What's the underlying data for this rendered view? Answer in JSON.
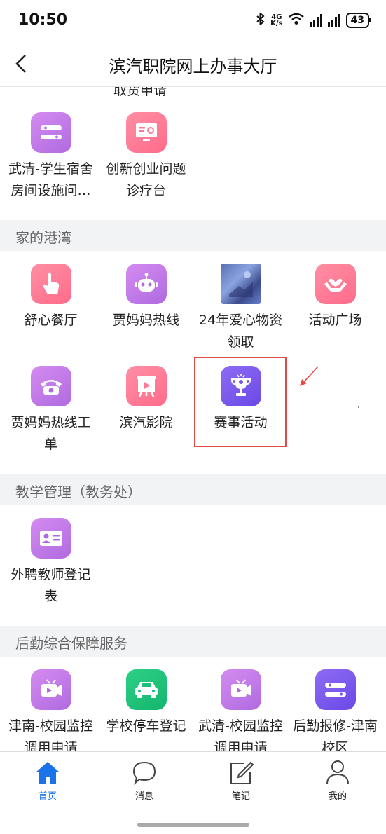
{
  "status": {
    "time": "10:50",
    "net_top": "4G",
    "net_bottom": "K/s",
    "battery": "43"
  },
  "nav": {
    "title": "滨汽职院网上办事大厅"
  },
  "top_cut_label": "取货申请",
  "top_tiles": [
    {
      "label": "武清-学生宿舍\n房间设施问…",
      "icon": "tools-icon"
    },
    {
      "label": "创新创业问题\n诊疗台",
      "icon": "monitor-settings-icon"
    }
  ],
  "sections": [
    {
      "title": "家的港湾",
      "tiles": [
        {
          "label": "舒心餐厅",
          "icon": "hand-pointer-icon"
        },
        {
          "label": "贾妈妈热线",
          "icon": "robot-icon"
        },
        {
          "label": "24年爱心物资\n领取",
          "icon": "photo-icon"
        },
        {
          "label": "活动广场",
          "icon": "heart-hands-icon"
        },
        {
          "label": "贾妈妈热线工\n单",
          "icon": "telephone-icon"
        },
        {
          "label": "滨汽影院",
          "icon": "projector-screen-icon"
        },
        {
          "label": "赛事活动",
          "icon": "trophy-icon"
        }
      ]
    },
    {
      "title": "教学管理（教务处）",
      "tiles": [
        {
          "label": "外聘教师登记\n表",
          "icon": "id-card-icon"
        }
      ]
    },
    {
      "title": "后勤综合保障服务",
      "tiles": [
        {
          "label": "津南-校园监控\n调用申请",
          "icon": "video-camera-icon"
        },
        {
          "label": "学校停车登记",
          "icon": "car-icon"
        },
        {
          "label": "武清-校园监控\n调用申请",
          "icon": "video-camera-icon"
        },
        {
          "label": "后勤报修-津南\n校区",
          "icon": "tools-icon"
        }
      ]
    }
  ],
  "tabbar": [
    {
      "label": "首页",
      "icon": "home-icon",
      "active": true
    },
    {
      "label": "消息",
      "icon": "chat-bubble-icon",
      "active": false
    },
    {
      "label": "笔记",
      "icon": "edit-note-icon",
      "active": false
    },
    {
      "label": "我的",
      "icon": "user-icon",
      "active": false
    }
  ],
  "colors": {
    "accent": "#1a73e8",
    "highlight": "#e24a45",
    "section_bg": "#f2f3f5"
  }
}
